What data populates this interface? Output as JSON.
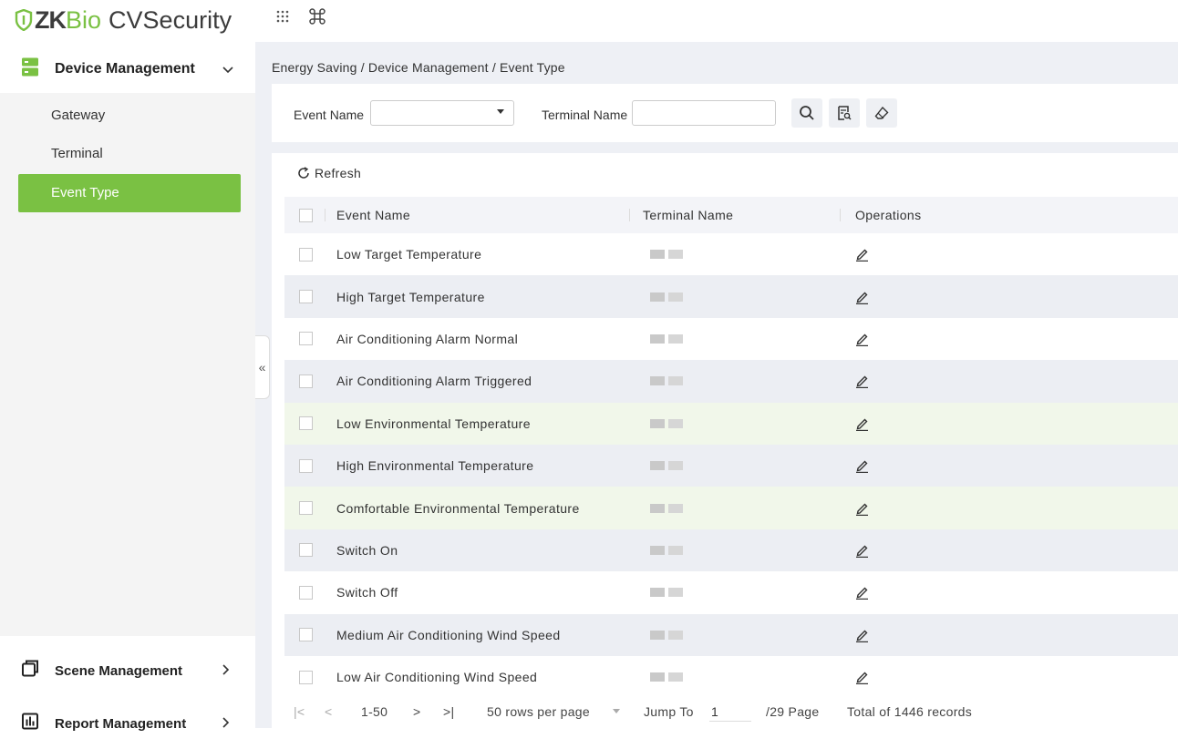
{
  "app": {
    "logo_zk": "ZK",
    "logo_bio": "Bio",
    "logo_cv": "CVSecurity",
    "brand_green": "#7ac143",
    "header_icons": [
      "apps-grid-icon",
      "command-icon"
    ]
  },
  "sidebar": {
    "sections": [
      {
        "label": "Device Management",
        "icon": "server-icon",
        "expanded": true
      },
      {
        "label": "Scene Management",
        "icon": "window-icon",
        "expanded": false
      },
      {
        "label": "Report Management",
        "icon": "bar-chart-icon",
        "expanded": false
      }
    ],
    "items": [
      {
        "label": "Gateway"
      },
      {
        "label": "Terminal"
      },
      {
        "label": "Event Type",
        "active": true
      }
    ],
    "collapse_label": "«"
  },
  "breadcrumb": "Energy Saving / Device Management / Event Type",
  "filters": {
    "event_name_label": "Event Name",
    "event_name_value": "",
    "terminal_name_label": "Terminal Name",
    "terminal_name_value": "",
    "buttons": [
      "search-icon",
      "advanced-search-icon",
      "clear-icon"
    ]
  },
  "toolbar": {
    "refresh_label": "Refresh"
  },
  "table": {
    "columns": [
      "Event Name",
      "Terminal Name",
      "Operations"
    ],
    "rows": [
      {
        "event_name": "Low Target Temperature",
        "terminal_name_blurred": true
      },
      {
        "event_name": "High Target Temperature",
        "terminal_name_blurred": true
      },
      {
        "event_name": "Air Conditioning Alarm Normal",
        "terminal_name_blurred": true
      },
      {
        "event_name": "Air Conditioning Alarm Triggered",
        "terminal_name_blurred": true
      },
      {
        "event_name": "Low Environmental Temperature",
        "terminal_name_blurred": true,
        "highlighted": true
      },
      {
        "event_name": "High Environmental Temperature",
        "terminal_name_blurred": true
      },
      {
        "event_name": "Comfortable Environmental Temperature",
        "terminal_name_blurred": true,
        "highlighted": true
      },
      {
        "event_name": "Switch On",
        "terminal_name_blurred": true
      },
      {
        "event_name": "Switch Off",
        "terminal_name_blurred": true
      },
      {
        "event_name": "Medium Air Conditioning Wind Speed",
        "terminal_name_blurred": true
      },
      {
        "event_name": "Low Air Conditioning Wind Speed",
        "terminal_name_blurred": true
      }
    ],
    "operation_icon": "edit-icon"
  },
  "pagination": {
    "first": "|<",
    "prev": "<",
    "range": "1-50",
    "next": ">",
    "last": ">|",
    "rows_per_page": "50 rows per page",
    "jump_to_label": "Jump To",
    "current_page": "1",
    "page_total": "/29 Page",
    "total_records": "Total of 1446 records"
  }
}
